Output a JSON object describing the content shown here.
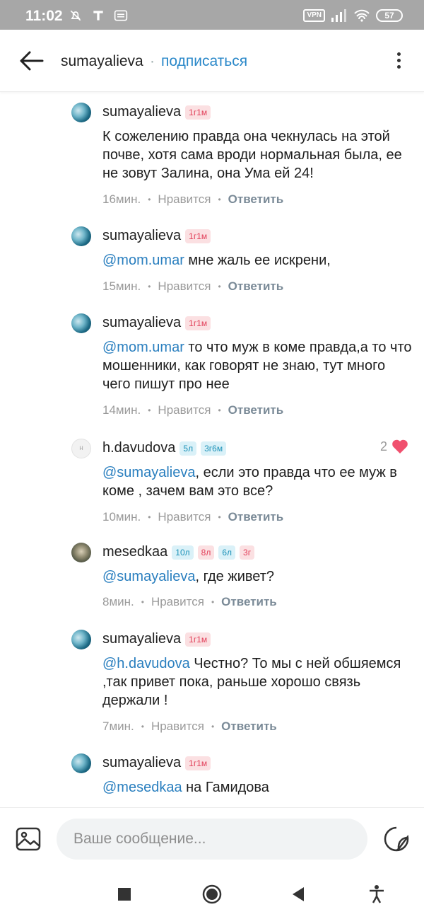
{
  "status_bar": {
    "time": "11:02",
    "vpn": "VPN",
    "battery": "57"
  },
  "header": {
    "username": "sumayalieva",
    "dot": "·",
    "subscribe": "подписаться"
  },
  "comments": [
    {
      "user": "sumayalieva",
      "badges": [
        {
          "text": "1г1м",
          "color": "red"
        }
      ],
      "mention": "",
      "text": "К сожелению правда она чекнулась на этой почве, хотя сама вроди нормальная была,   ее не зовут Залина,  она Ума  ей 24!",
      "time": "16мин.",
      "like": "Нравится",
      "reply": "Ответить"
    },
    {
      "user": "sumayalieva",
      "badges": [
        {
          "text": "1г1м",
          "color": "red"
        }
      ],
      "mention": "@mom.umar",
      "text": " мне жаль ее искрени,",
      "time": "15мин.",
      "like": "Нравится",
      "reply": "Ответить"
    },
    {
      "user": "sumayalieva",
      "badges": [
        {
          "text": "1г1м",
          "color": "red"
        }
      ],
      "mention": "@mom.umar",
      "text": " то что муж в коме правда,а то что мошенники, как говорят не знаю, тут много чего пишут про нее",
      "time": "14мин.",
      "like": "Нравится",
      "reply": "Ответить"
    },
    {
      "user": "h.davudova",
      "badges": [
        {
          "text": "5л",
          "color": "blue"
        },
        {
          "text": "3г6м",
          "color": "blue"
        }
      ],
      "mention": "@sumayalieva",
      "text": ", если это правда что ее муж в коме , зачем вам это все?",
      "time": "10мин.",
      "like": "Нравится",
      "reply": "Ответить",
      "likes_count": "2",
      "avatar_letter": "н"
    },
    {
      "user": "mesedkaa",
      "badges": [
        {
          "text": "10л",
          "color": "blue"
        },
        {
          "text": "8л",
          "color": "red"
        },
        {
          "text": "6л",
          "color": "blue"
        },
        {
          "text": "3г",
          "color": "red"
        }
      ],
      "mention": "@sumayalieva",
      "text": ", где живет?",
      "time": "8мин.",
      "like": "Нравится",
      "reply": "Ответить"
    },
    {
      "user": "sumayalieva",
      "badges": [
        {
          "text": "1г1м",
          "color": "red"
        }
      ],
      "mention": "@h.davudova",
      "text": " Честно?  То мы с ней обшяемся ,так привет пока, раньше хорошо связь держали !",
      "time": "7мин.",
      "like": "Нравится",
      "reply": "Ответить"
    },
    {
      "user": "sumayalieva",
      "badges": [
        {
          "text": "1г1м",
          "color": "red"
        }
      ],
      "mention": "@mesedkaa",
      "text": " на Гамидова",
      "time": "",
      "like": "",
      "reply": ""
    }
  ],
  "composer": {
    "placeholder": "Ваше сообщение..."
  },
  "icons": {
    "back": "arrow-left-icon",
    "menu": "more-vertical-icon",
    "image": "image-icon",
    "sticker": "sticker-icon",
    "heart": "heart-icon",
    "nav_recent": "square-icon",
    "nav_home": "circle-icon",
    "nav_back": "triangle-icon",
    "accessibility": "accessibility-icon"
  },
  "colors": {
    "accent": "#2a88c9",
    "heart": "#f0506e",
    "badge_red_bg": "#fbe0e2",
    "badge_blue_bg": "#daf1f8"
  }
}
